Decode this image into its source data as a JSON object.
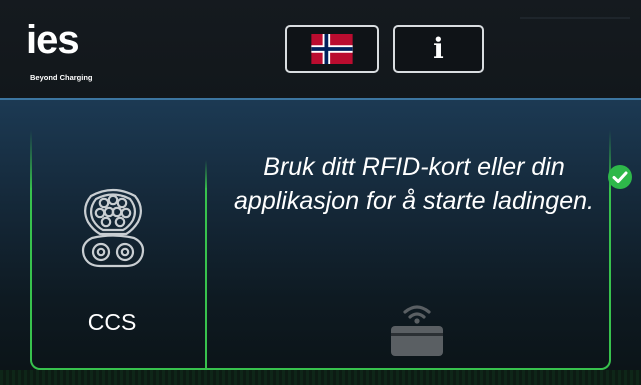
{
  "brand": {
    "logo_text": "ies",
    "tagline": "Beyond Charging"
  },
  "header": {
    "language_button": {
      "icon": "norway-flag-icon",
      "label": ""
    },
    "info_button": {
      "icon": "info-icon",
      "label": "i"
    }
  },
  "connector": {
    "icon": "ccs-connector-icon",
    "label": "CCS",
    "status_icon": "check-circle-icon",
    "status_color": "#2eb84a"
  },
  "instruction": {
    "text": "Bruk ditt RFID-kort eller din applikasjon for å starte ladingen.",
    "icon": "rfid-card-icon"
  },
  "colors": {
    "accent_green": "#38c24d",
    "panel_blue": "#1c3a54",
    "button_border": "#d9dde0"
  }
}
